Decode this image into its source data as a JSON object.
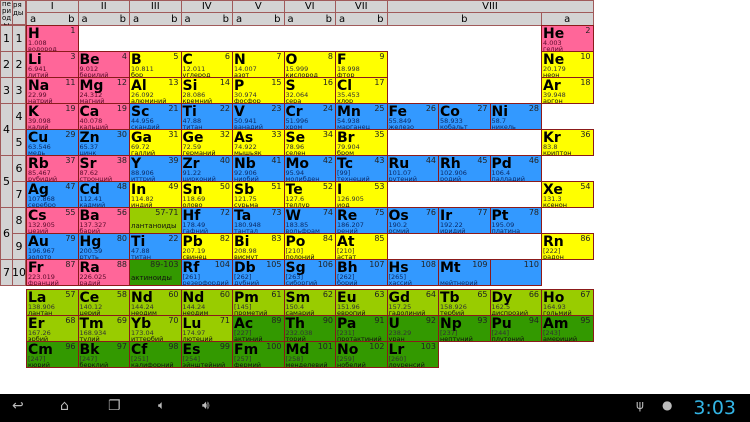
{
  "header": {
    "periods_label": "периоды",
    "rows_label": "ряды",
    "groups": [
      "I",
      "II",
      "III",
      "IV",
      "V",
      "VI",
      "VII",
      "VIII"
    ],
    "sub_a": "a",
    "sub_b": "b"
  },
  "periods": [
    "1",
    "2",
    "3",
    "4",
    "5",
    "6",
    "7"
  ],
  "row_numbers": [
    "1",
    "2",
    "3",
    "4",
    "5",
    "6",
    "7",
    "8",
    "9",
    "10"
  ],
  "colors": {
    "s": "#ff6699",
    "p": "#ffff00",
    "d": "#3399ff",
    "la": "#99cc00",
    "ac": "#339900",
    "border": "#8b1a1a",
    "header": "#d3d3d3"
  },
  "table": [
    [
      {
        "s": "H",
        "n": "1",
        "m": "1.008",
        "name": "водород",
        "t": "s"
      },
      null,
      null,
      null,
      null,
      null,
      null,
      null,
      null,
      null,
      {
        "s": "He",
        "n": "2",
        "m": "4.003",
        "name": "гелий",
        "t": "s"
      }
    ],
    [
      {
        "s": "Li",
        "n": "3",
        "m": "6.941",
        "name": "литий",
        "t": "s"
      },
      {
        "s": "Be",
        "n": "4",
        "m": "9.012",
        "name": "берилий",
        "t": "s"
      },
      {
        "s": "B",
        "n": "5",
        "m": "10.811",
        "name": "бор",
        "t": "p"
      },
      {
        "s": "C",
        "n": "6",
        "m": "12.011",
        "name": "углерод",
        "t": "p"
      },
      {
        "s": "N",
        "n": "7",
        "m": "14.007",
        "name": "азот",
        "t": "p"
      },
      {
        "s": "O",
        "n": "8",
        "m": "15.999",
        "name": "кислород",
        "t": "p"
      },
      {
        "s": "F",
        "n": "9",
        "m": "18.998",
        "name": "фтор",
        "t": "p"
      },
      null,
      null,
      null,
      {
        "s": "Ne",
        "n": "10",
        "m": "20.179",
        "name": "неон",
        "t": "p"
      }
    ],
    [
      {
        "s": "Na",
        "n": "11",
        "m": "22.99",
        "name": "натрий",
        "t": "s"
      },
      {
        "s": "Mg",
        "n": "12",
        "m": "24.312",
        "name": "магний",
        "t": "s"
      },
      {
        "s": "Al",
        "n": "13",
        "m": "26.092",
        "name": "алюминий",
        "t": "p"
      },
      {
        "s": "Si",
        "n": "14",
        "m": "28.086",
        "name": "кремний",
        "t": "p"
      },
      {
        "s": "P",
        "n": "15",
        "m": "30.974",
        "name": "фосфор",
        "t": "p"
      },
      {
        "s": "S",
        "n": "16",
        "m": "32.064",
        "name": "сера",
        "t": "p"
      },
      {
        "s": "Cl",
        "n": "17",
        "m": "35.453",
        "name": "хлор",
        "t": "p"
      },
      null,
      null,
      null,
      {
        "s": "Ar",
        "n": "18",
        "m": "39.948",
        "name": "аргон",
        "t": "p"
      }
    ],
    [
      {
        "s": "K",
        "n": "19",
        "m": "39.098",
        "name": "калий",
        "t": "s"
      },
      {
        "s": "Ca",
        "n": "19",
        "m": "40.078",
        "name": "кальций",
        "t": "s"
      },
      {
        "s": "Sc",
        "n": "21",
        "m": "44.956",
        "name": "скандий",
        "t": "d"
      },
      {
        "s": "Ti",
        "n": "22",
        "m": "47.88",
        "name": "титан",
        "t": "d"
      },
      {
        "s": "V",
        "n": "23",
        "m": "50.941",
        "name": "ванадий",
        "t": "d"
      },
      {
        "s": "Cr",
        "n": "24",
        "m": "51.996",
        "name": "хром",
        "t": "d"
      },
      {
        "s": "Mn",
        "n": "25",
        "m": "54.938",
        "name": "марганец",
        "t": "d"
      },
      {
        "s": "Fe",
        "n": "26",
        "m": "55.849",
        "name": "железо",
        "t": "d"
      },
      {
        "s": "Co",
        "n": "27",
        "m": "58.933",
        "name": "кобальт",
        "t": "d"
      },
      {
        "s": "Ni",
        "n": "28",
        "m": "58.7",
        "name": "никель",
        "t": "d"
      },
      null
    ],
    [
      {
        "s": "Cu",
        "n": "29",
        "m": "63.546",
        "name": "медь",
        "t": "d"
      },
      {
        "s": "Zn",
        "n": "30",
        "m": "65.37",
        "name": "цинк",
        "t": "d"
      },
      {
        "s": "Ga",
        "n": "31",
        "m": "69.72",
        "name": "галлий",
        "t": "p"
      },
      {
        "s": "Ge",
        "n": "32",
        "m": "72.59",
        "name": "германий",
        "t": "p"
      },
      {
        "s": "As",
        "n": "33",
        "m": "74.922",
        "name": "мышьяк",
        "t": "p"
      },
      {
        "s": "Se",
        "n": "34",
        "m": "78.96",
        "name": "селен",
        "t": "p"
      },
      {
        "s": "Br",
        "n": "35",
        "m": "79.904",
        "name": "бром",
        "t": "p"
      },
      null,
      null,
      null,
      {
        "s": "Kr",
        "n": "36",
        "m": "83.8",
        "name": "криптон",
        "t": "p"
      }
    ],
    [
      {
        "s": "Rb",
        "n": "37",
        "m": "85.467",
        "name": "рубидий",
        "t": "s"
      },
      {
        "s": "Sr",
        "n": "38",
        "m": "87.62",
        "name": "стронций",
        "t": "s"
      },
      {
        "s": "Y",
        "n": "39",
        "m": "88.906",
        "name": "иттрий",
        "t": "d"
      },
      {
        "s": "Zr",
        "n": "40",
        "m": "91.22",
        "name": "цирконий",
        "t": "d"
      },
      {
        "s": "Nb",
        "n": "41",
        "m": "92.906",
        "name": "ниобий",
        "t": "d"
      },
      {
        "s": "Mo",
        "n": "42",
        "m": "95.94",
        "name": "молибден",
        "t": "d"
      },
      {
        "s": "Tc",
        "n": "43",
        "m": "[99]",
        "name": "технеций",
        "t": "d"
      },
      {
        "s": "Ru",
        "n": "44",
        "m": "101.07",
        "name": "рутений",
        "t": "d"
      },
      {
        "s": "Rh",
        "n": "45",
        "m": "102.906",
        "name": "родий",
        "t": "d"
      },
      {
        "s": "Pd",
        "n": "46",
        "m": "106.4",
        "name": "палладий",
        "t": "d"
      },
      null
    ],
    [
      {
        "s": "Ag",
        "n": "47",
        "m": "107.868",
        "name": "серебро",
        "t": "d"
      },
      {
        "s": "Cd",
        "n": "48",
        "m": "112.41",
        "name": "кадмий",
        "t": "d"
      },
      {
        "s": "In",
        "n": "49",
        "m": "114.82",
        "name": "индий",
        "t": "p"
      },
      {
        "s": "Sn",
        "n": "50",
        "m": "118.69",
        "name": "олово",
        "t": "p"
      },
      {
        "s": "Sb",
        "n": "51",
        "m": "121.75",
        "name": "сурьма",
        "t": "p"
      },
      {
        "s": "Te",
        "n": "52",
        "m": "127.6",
        "name": "теллур",
        "t": "p"
      },
      {
        "s": "I",
        "n": "53",
        "m": "126.905",
        "name": "иод",
        "t": "p"
      },
      null,
      null,
      null,
      {
        "s": "Xe",
        "n": "54",
        "m": "131.3",
        "name": "ксенон",
        "t": "p"
      }
    ],
    [
      {
        "s": "Cs",
        "n": "55",
        "m": "132.905",
        "name": "цезий",
        "t": "s"
      },
      {
        "s": "Ba",
        "n": "56",
        "m": "137.327",
        "name": "барий",
        "t": "s"
      },
      {
        "s": "",
        "n": "57-71",
        "m": "",
        "name": "лантаноиды",
        "t": "la",
        "g": true
      },
      {
        "s": "Hf",
        "n": "72",
        "m": "178.49",
        "name": "гафний",
        "t": "d"
      },
      {
        "s": "Ta",
        "n": "73",
        "m": "180.948",
        "name": "тантал",
        "t": "d"
      },
      {
        "s": "W",
        "n": "74",
        "m": "183.85",
        "name": "вольфрам",
        "t": "d"
      },
      {
        "s": "Re",
        "n": "75",
        "m": "186.207",
        "name": "рений",
        "t": "d"
      },
      {
        "s": "Os",
        "n": "76",
        "m": "190.2",
        "name": "осмий",
        "t": "d"
      },
      {
        "s": "Ir",
        "n": "77",
        "m": "192.22",
        "name": "иридий",
        "t": "d"
      },
      {
        "s": "Pt",
        "n": "78",
        "m": "195.09",
        "name": "платина",
        "t": "d"
      },
      null
    ],
    [
      {
        "s": "Au",
        "n": "79",
        "m": "196.967",
        "name": "золото",
        "t": "d"
      },
      {
        "s": "Hg",
        "n": "80",
        "m": "200.59",
        "name": "ртуть",
        "t": "d"
      },
      {
        "s": "Ti",
        "n": "22",
        "m": "47.88",
        "name": "титан",
        "t": "d"
      },
      {
        "s": "Pb",
        "n": "82",
        "m": "207.19",
        "name": "свинец",
        "t": "p"
      },
      {
        "s": "Bi",
        "n": "83",
        "m": "208.98",
        "name": "висмут",
        "t": "p"
      },
      {
        "s": "Po",
        "n": "84",
        "m": "[210]",
        "name": "полоний",
        "t": "p"
      },
      {
        "s": "At",
        "n": "85",
        "m": "[210]",
        "name": "астат",
        "t": "p"
      },
      null,
      null,
      null,
      {
        "s": "Rn",
        "n": "86",
        "m": "[222]",
        "name": "радон",
        "t": "p"
      }
    ],
    [
      {
        "s": "Fr",
        "n": "87",
        "m": "223.019",
        "name": "франций",
        "t": "s"
      },
      {
        "s": "Ra",
        "n": "88",
        "m": "226.025",
        "name": "радий",
        "t": "s"
      },
      {
        "s": "",
        "n": "89-103",
        "m": "",
        "name": "актиноиды",
        "t": "ac",
        "g": true
      },
      {
        "s": "Rf",
        "n": "104",
        "m": "[261]",
        "name": "резерфордий",
        "t": "d"
      },
      {
        "s": "Db",
        "n": "105",
        "m": "[262]",
        "name": "дубний",
        "t": "d"
      },
      {
        "s": "Sg",
        "n": "106",
        "m": "[263]",
        "name": "сиборгий",
        "t": "d"
      },
      {
        "s": "Bh",
        "n": "107",
        "m": "[262]",
        "name": "борий",
        "t": "d"
      },
      {
        "s": "Hs",
        "n": "108",
        "m": "[265]",
        "name": "хассий",
        "t": "d"
      },
      {
        "s": "Mt",
        "n": "109",
        "m": "",
        "name": "мейтнерий",
        "t": "d"
      },
      {
        "s": "",
        "n": "110",
        "m": "",
        "name": "",
        "t": "d"
      },
      null
    ]
  ],
  "fblock": [
    [
      {
        "s": "La",
        "n": "57",
        "m": "138.906",
        "name": "лантан",
        "t": "la"
      },
      {
        "s": "Ce",
        "n": "58",
        "m": "140.12",
        "name": "церий",
        "t": "la"
      },
      {
        "s": "Nd",
        "n": "60",
        "m": "144.24",
        "name": "неодим",
        "t": "la"
      },
      {
        "s": "Nd",
        "n": "60",
        "m": "144.24",
        "name": "неодим",
        "t": "la"
      },
      {
        "s": "Pm",
        "n": "61",
        "m": "[145]",
        "name": "прометий",
        "t": "la"
      },
      {
        "s": "Sm",
        "n": "62",
        "m": "150.4",
        "name": "самарий",
        "t": "la"
      },
      {
        "s": "Eu",
        "n": "63",
        "m": "151.96",
        "name": "европий",
        "t": "la"
      },
      {
        "s": "Gd",
        "n": "64",
        "m": "157.25",
        "name": "гадолиний",
        "t": "la"
      },
      {
        "s": "Tb",
        "n": "65",
        "m": "158.926",
        "name": "тербий",
        "t": "la"
      },
      {
        "s": "Dy",
        "n": "66",
        "m": "162.5",
        "name": "диспрозий",
        "t": "la"
      },
      {
        "s": "Ho",
        "n": "67",
        "m": "164.93",
        "name": "гольмий",
        "t": "la"
      }
    ],
    [
      {
        "s": "Er",
        "n": "68",
        "m": "167.26",
        "name": "эрбий",
        "t": "la"
      },
      {
        "s": "Tm",
        "n": "69",
        "m": "168.934",
        "name": "тулий",
        "t": "la"
      },
      {
        "s": "Yb",
        "n": "70",
        "m": "173.04",
        "name": "иттербий",
        "t": "la"
      },
      {
        "s": "Lu",
        "n": "71",
        "m": "174.97",
        "name": "лютеций",
        "t": "la"
      },
      {
        "s": "Ac",
        "n": "89",
        "m": "[227]",
        "name": "актиний",
        "t": "ac"
      },
      {
        "s": "Th",
        "n": "90",
        "m": "232.038",
        "name": "торий",
        "t": "ac"
      },
      {
        "s": "Pa",
        "n": "91",
        "m": "[231]",
        "name": "протактиний",
        "t": "ac"
      },
      {
        "s": "U",
        "n": "92",
        "m": "238.29",
        "name": "уран",
        "t": "ac"
      },
      {
        "s": "Np",
        "n": "93",
        "m": "[237]",
        "name": "нептуний",
        "t": "ac"
      },
      {
        "s": "Pu",
        "n": "94",
        "m": "[244]",
        "name": "плутоний",
        "t": "ac"
      },
      {
        "s": "Am",
        "n": "95",
        "m": "[243]",
        "name": "америций",
        "t": "ac"
      }
    ],
    [
      {
        "s": "Cm",
        "n": "96",
        "m": "[247]",
        "name": "кюрий",
        "t": "ac"
      },
      {
        "s": "Bk",
        "n": "97",
        "m": "[247]",
        "name": "берклий",
        "t": "ac"
      },
      {
        "s": "Cf",
        "n": "98",
        "m": "[251]",
        "name": "калифорний",
        "t": "ac"
      },
      {
        "s": "Es",
        "n": "99",
        "m": "[254]",
        "name": "эйнштейний",
        "t": "ac"
      },
      {
        "s": "Fm",
        "n": "100",
        "m": "[257]",
        "name": "фермий",
        "t": "ac"
      },
      {
        "s": "Md",
        "n": "101",
        "m": "[258]",
        "name": "менделевий",
        "t": "ac"
      },
      {
        "s": "No",
        "n": "102",
        "m": "[259]",
        "name": "нобелий",
        "t": "ac"
      },
      {
        "s": "Lr",
        "n": "103",
        "m": "[260]",
        "name": "лоуренсий",
        "t": "ac"
      }
    ]
  ],
  "statusbar": {
    "clock": "3:03",
    "icons": [
      "back-icon",
      "home-icon",
      "recent-apps-icon",
      "volume-down-icon",
      "volume-up-icon",
      "usb-icon",
      "android-debug-icon"
    ]
  }
}
